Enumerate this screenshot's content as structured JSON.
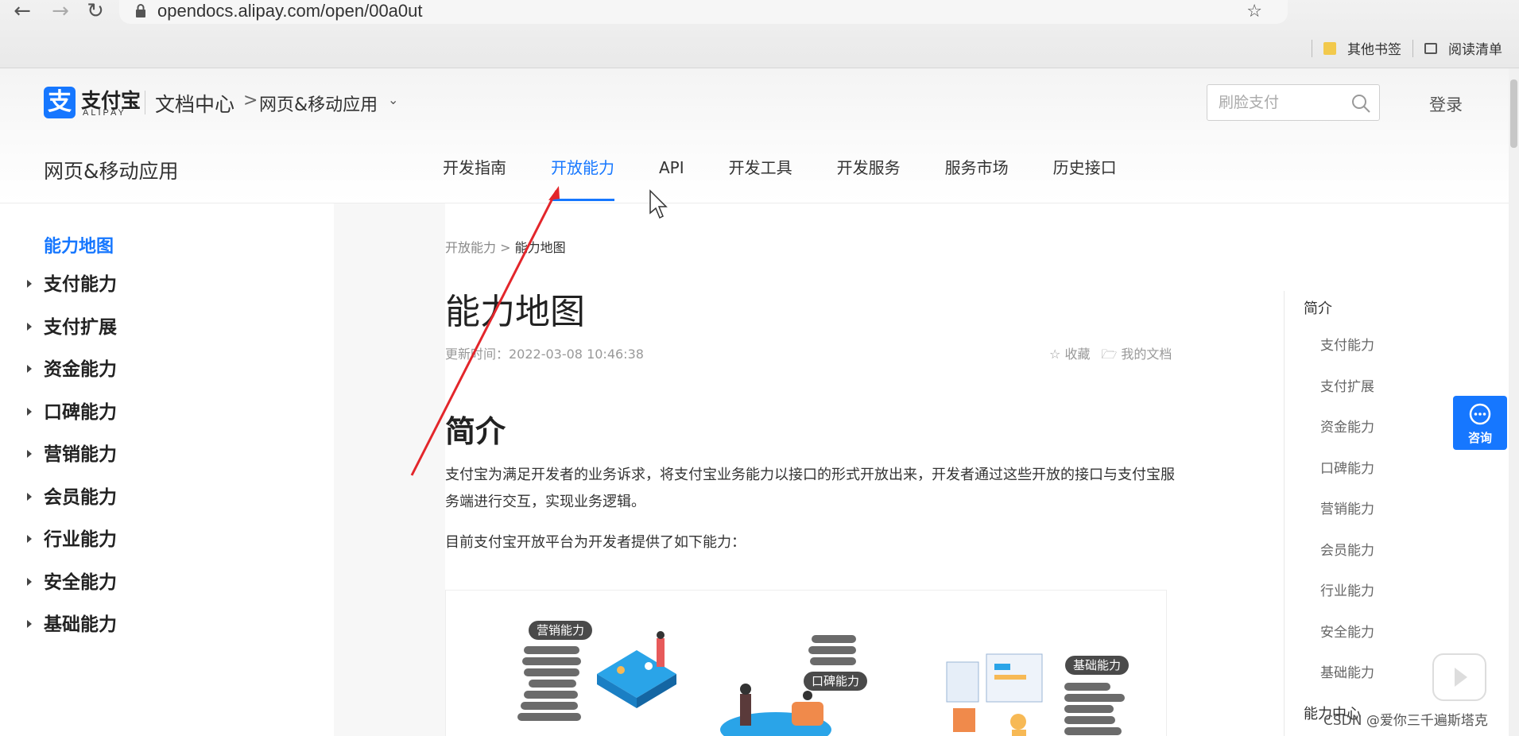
{
  "browser": {
    "url": "opendocs.alipay.com/open/00a0ut",
    "bookmarks": [
      {
        "label": "其他书签",
        "icon": "folder-icon"
      },
      {
        "label": "阅读清单",
        "icon": "reading-list-icon"
      }
    ]
  },
  "header": {
    "logo_text": "支付宝",
    "logo_sub": "ALIPAY",
    "doc_center": "文档中心",
    "crumb_sep": ">",
    "crumb_app": "网页&移动应用",
    "search_placeholder": "刷脸支付",
    "login": "登录"
  },
  "subnav": {
    "section_title": "网页&移动应用",
    "tabs": [
      {
        "label": "开发指南",
        "active": false
      },
      {
        "label": "开放能力",
        "active": true
      },
      {
        "label": "API",
        "active": false
      },
      {
        "label": "开发工具",
        "active": false
      },
      {
        "label": "开发服务",
        "active": false
      },
      {
        "label": "服务市场",
        "active": false
      },
      {
        "label": "历史接口",
        "active": false
      }
    ]
  },
  "sidebar": {
    "current": "能力地图",
    "items": [
      "支付能力",
      "支付扩展",
      "资金能力",
      "口碑能力",
      "营销能力",
      "会员能力",
      "行业能力",
      "安全能力",
      "基础能力"
    ]
  },
  "main": {
    "breadcrumb_parent": "开放能力",
    "breadcrumb_sep": ">",
    "breadcrumb_current": "能力地图",
    "title": "能力地图",
    "updated": "更新时间：2022-03-08 10:46:38",
    "collect": "收藏",
    "my_docs": "我的文档",
    "section_heading": "简介",
    "intro": "支付宝为满足开发者的业务诉求，将支付宝业务能力以接口的形式开放出来，开发者通过这些开放的接口与支付宝服务端进行交互，实现业务逻辑。",
    "intro2": "目前支付宝开放平台为开发者提供了如下能力：",
    "figure_tags": [
      "营销能力",
      "口碑能力",
      "基础能力"
    ]
  },
  "toc": {
    "heading": "简介",
    "items": [
      "支付能力",
      "支付扩展",
      "资金能力",
      "口碑能力",
      "营销能力",
      "会员能力",
      "行业能力",
      "安全能力",
      "基础能力"
    ],
    "footer": "能力中心"
  },
  "consult": {
    "label": "咨询"
  },
  "watermark": "CSDN @爱你三千遍斯塔克",
  "colors": {
    "accent": "#1677ff",
    "annotation": "#e3262b"
  }
}
